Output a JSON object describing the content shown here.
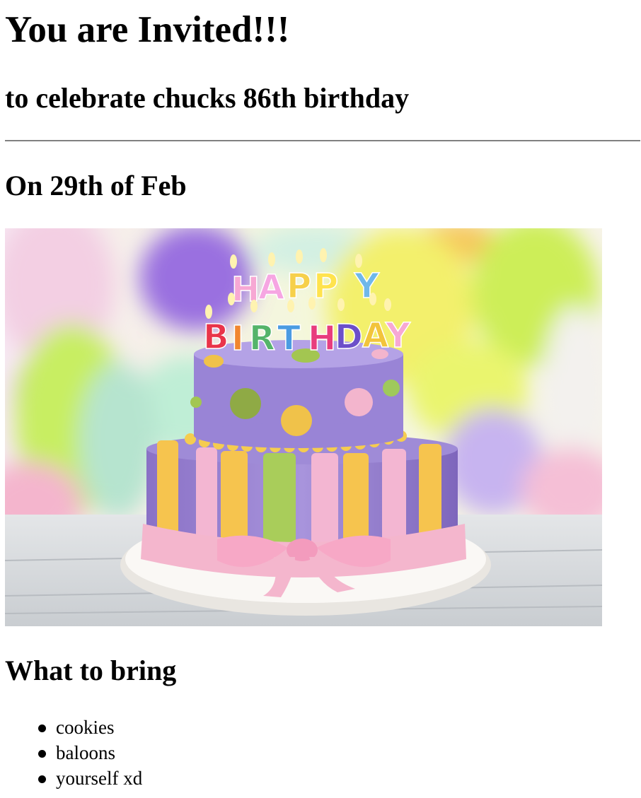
{
  "page": {
    "title": "You are Invited!!!",
    "subtitle": "to celebrate chucks 86th birthday",
    "date_heading": "On 29th of Feb",
    "image": {
      "subject": "cake-photo",
      "candle_letters": [
        "H",
        "A",
        "P",
        "P",
        "Y",
        "B",
        "I",
        "R",
        "T",
        "H",
        "D",
        "A",
        "Y"
      ]
    },
    "bring_heading": "What to bring",
    "bring_items": [
      "cookies",
      "baloons",
      "yourself xd"
    ]
  },
  "colors": {
    "text": "#000000",
    "rule": "#808080",
    "background": "#ffffff"
  }
}
